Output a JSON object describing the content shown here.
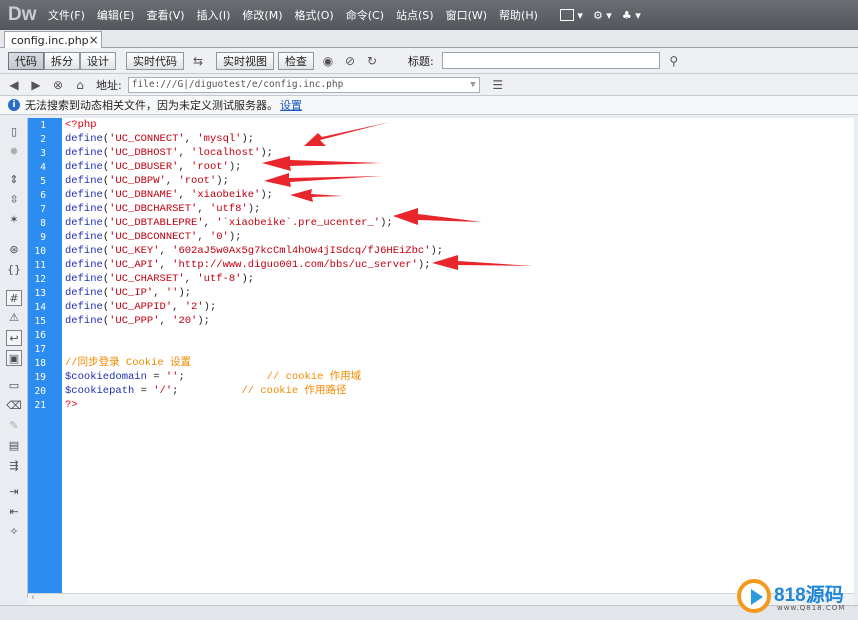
{
  "app": {
    "logo": "Dw"
  },
  "menu": [
    "文件(F)",
    "编辑(E)",
    "查看(V)",
    "插入(I)",
    "修改(M)",
    "格式(O)",
    "命令(C)",
    "站点(S)",
    "窗口(W)",
    "帮助(H)"
  ],
  "tab": {
    "filename": "config.inc.php",
    "close": "×"
  },
  "toolbar": {
    "code": "代码",
    "split": "拆分",
    "design": "设计",
    "live_code": "实时代码",
    "live_view": "实时视图",
    "inspect": "检查",
    "title_label": "标题:",
    "title_value": ""
  },
  "address": {
    "label": "地址:",
    "value": "file:///G|/diguotest/e/config.inc.php"
  },
  "infobar": {
    "message": "无法搜索到动态相关文件，因为未定义测试服务器。",
    "link": "设置"
  },
  "code_lines": [
    "1",
    "2",
    "3",
    "4",
    "5",
    "6",
    "7",
    "8",
    "9",
    "10",
    "11",
    "12",
    "13",
    "14",
    "15",
    "16",
    "17",
    "18",
    "19",
    "20",
    "21"
  ],
  "code": {
    "open": "<?php",
    "defines": [
      {
        "key": "'UC_CONNECT'",
        "val": "'mysql'"
      },
      {
        "key": "'UC_DBHOST'",
        "val": "'localhost'"
      },
      {
        "key": "'UC_DBUSER'",
        "val": "'root'"
      },
      {
        "key": "'UC_DBPW'",
        "val": "'root'"
      },
      {
        "key": "'UC_DBNAME'",
        "val": "'xiaobeike'"
      },
      {
        "key": "'UC_DBCHARSET'",
        "val": "'utf8'"
      },
      {
        "key": "'UC_DBTABLEPRE'",
        "val": "'`xiaobeike`.pre_ucenter_'"
      },
      {
        "key": "'UC_DBCONNECT'",
        "val": "'0'"
      },
      {
        "key": "'UC_KEY'",
        "val": "'602aJ5w0Ax5g7kcCml4hOw4jISdcq/fJ6HEiZbc'"
      },
      {
        "key": "'UC_API'",
        "val": "'http://www.diguo001.com/bbs/uc_server'"
      },
      {
        "key": "'UC_CHARSET'",
        "val": "'utf-8'"
      },
      {
        "key": "'UC_IP'",
        "val": "''"
      },
      {
        "key": "'UC_APPID'",
        "val": "'2'"
      },
      {
        "key": "'UC_PPP'",
        "val": "'20'"
      }
    ],
    "define_kw": "define",
    "comment_sync": "//同步登录 Cookie 设置",
    "domain_var": "$cookiedomain",
    "domain_val": "''",
    "domain_comment": "// cookie 作用域",
    "path_var": "$cookiepath",
    "path_val": "'/'",
    "path_comment": "// cookie 作用路径",
    "close": "?>"
  },
  "watermark": {
    "brand": "818源码",
    "url": "www.Q818.COM"
  },
  "colors": {
    "gutter": "#2d8cf0",
    "arrow": "#e8262b",
    "menubar": "#5d6167"
  }
}
